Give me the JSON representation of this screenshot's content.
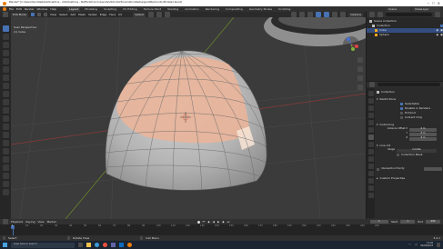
{
  "window": {
    "title": "Blender* [C:\\Users\\hero\\Desktop\\OneDrive - UoS\\OneDrive - Staffordshire University\\2022-2023\\Animation\\Redesigned\\Back\\ordin\\Modeled.blend]"
  },
  "menu": {
    "items": [
      "File",
      "Edit",
      "Render",
      "Window",
      "Help"
    ]
  },
  "workspace_tabs": [
    "Layout",
    "Modeling",
    "Sculpting",
    "UV Editing",
    "Texture Paint",
    "Shading",
    "Animation",
    "Rendering",
    "Compositing",
    "Geometry Nodes",
    "Scripting"
  ],
  "header": {
    "mode": "Edit Mode",
    "view": "View",
    "select": "Select",
    "add": "Add",
    "mesh": "Mesh",
    "vertex": "Vertex",
    "edge": "Edge",
    "face": "Face",
    "uv": "UV",
    "transform": "Global",
    "scene": "Scene",
    "view_layer": "ViewLayer",
    "options": "Options"
  },
  "viewport": {
    "overlay_line1": "User Perspective",
    "overlay_line2": "(1) Cube"
  },
  "outliner": {
    "rows": [
      {
        "label": "Scene Collection",
        "selected": false,
        "icon": "collection-icon"
      },
      {
        "label": "Collection",
        "selected": false,
        "icon": "collection-icon"
      },
      {
        "label": "Cube",
        "selected": true,
        "icon": "mesh-icon"
      },
      {
        "label": "Sphere",
        "selected": false,
        "icon": "mesh-icon"
      }
    ]
  },
  "properties": {
    "breadcrumb": "Collection",
    "search_placeholder": "",
    "restrictions": {
      "title": "Restrictions",
      "selectable": "Selectable",
      "disable_in_renders": "Disable in Renders",
      "holdout": "Holdout",
      "indirect_only": "Indirect Only"
    },
    "instancing": {
      "title": "Instancing",
      "offset_label": "Instance Offset X",
      "y_label": "Y",
      "z_label": "Z",
      "x": "0 m",
      "y": "0 m",
      "z": "0 m"
    },
    "line_art": {
      "title": "Line Art",
      "usage_label": "Usage",
      "usage_value": "Include",
      "collection_mask": "Collection Mask"
    },
    "intersection_priority": "Intersection Priority",
    "custom_properties": "Custom Properties"
  },
  "timeline": {
    "playback": "Playback",
    "keying": "Keying",
    "view": "View",
    "marker": "Marker",
    "current_frame": "1",
    "start_label": "Start",
    "start": "1",
    "end_label": "End",
    "end": "250",
    "ticks": [
      "0",
      "10",
      "20",
      "30",
      "40",
      "50",
      "60",
      "70",
      "80",
      "90",
      "100",
      "110",
      "120",
      "130",
      "140",
      "150",
      "160",
      "170",
      "180",
      "190",
      "200",
      "210",
      "220",
      "230",
      "240",
      "250"
    ]
  },
  "statusbar": {
    "select": "Select",
    "rotate": "Rotate View",
    "call_menu": "Call Menu",
    "version": "3.4.1"
  },
  "taskbar": {
    "search_placeholder": "Type here to search",
    "time": "11:42",
    "date": "04/04/2023"
  },
  "colors": {
    "selected_face": "#e8b49a",
    "mesh_base": "#b9b9b9",
    "accent": "#4772b3",
    "header": "#303030",
    "panel": "#2b2b2b"
  }
}
